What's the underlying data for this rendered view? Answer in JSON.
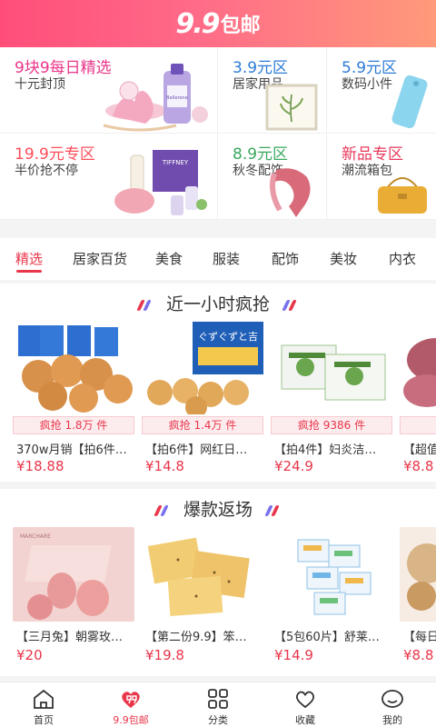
{
  "header": {
    "logo_num": "9.9",
    "logo_text": "包邮"
  },
  "promo": [
    {
      "title": "9块9每日精选",
      "sub": "十元封顶"
    },
    {
      "title": "3.9元区",
      "sub": "居家用品"
    },
    {
      "title": "5.9元区",
      "sub": "数码小件"
    },
    {
      "title": "19.9元专区",
      "sub": "半价抢不停"
    },
    {
      "title": "8.9元区",
      "sub": "秋冬配饰"
    },
    {
      "title": "新品专区",
      "sub": "潮流箱包"
    }
  ],
  "promo_art_text": {
    "bottle_label": "Bellerene",
    "box_label": "TIFFNEY"
  },
  "tabs": [
    "精选",
    "居家百货",
    "美食",
    "服装",
    "配饰",
    "美妆",
    "内衣"
  ],
  "flash": {
    "title": "近一小时疯抢",
    "items": [
      {
        "badge": "疯抢 1.8万 件",
        "name": "370w月销【拍6件…",
        "price": "¥18.88"
      },
      {
        "badge": "疯抢 1.4万 件",
        "name": "【拍6件】网红日…",
        "price": "¥14.8",
        "pkg_text": "ぐずぐずと吉"
      },
      {
        "badge": "疯抢 9386 件",
        "name": "【拍4件】妇炎洁…",
        "price": "¥24.9"
      },
      {
        "badge": "疯",
        "name": "【超值",
        "price": "¥8.8"
      }
    ]
  },
  "hot": {
    "title": "爆款返场",
    "items": [
      {
        "name": "【三月兔】朝雾玫…",
        "price": "¥20",
        "brand": "MARCHARE"
      },
      {
        "name": "【第二份9.9】笨…",
        "price": "¥19.8"
      },
      {
        "name": "【5包60片】舒莱…",
        "price": "¥14.9"
      },
      {
        "name": "【每日",
        "price": "¥8.8"
      }
    ]
  },
  "nav": [
    {
      "label": "首页",
      "icon": "home-icon"
    },
    {
      "label": "9.9包邮",
      "icon": "ninety-nine-icon"
    },
    {
      "label": "分类",
      "icon": "grid-icon"
    },
    {
      "label": "收藏",
      "icon": "heart-icon"
    },
    {
      "label": "我的",
      "icon": "profile-icon"
    }
  ],
  "colors": {
    "accent": "#e8364a",
    "header_start": "#ff4e7a",
    "header_end": "#ff9a7a"
  }
}
